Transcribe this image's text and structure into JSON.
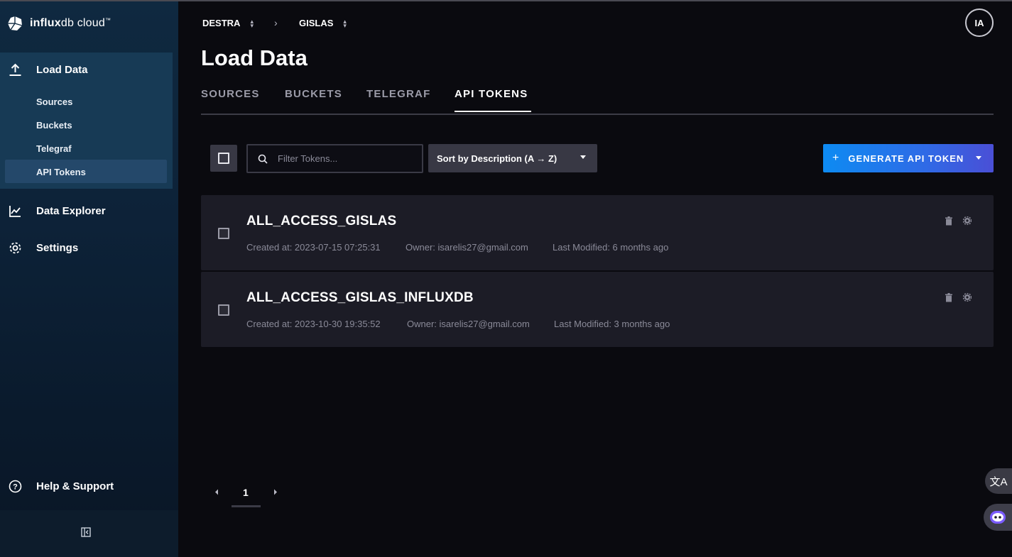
{
  "brand": {
    "name_bold": "influx",
    "name_rest": "db cloud",
    "trademark": "™"
  },
  "sidebar": {
    "load_data": "Load Data",
    "sub_items": [
      {
        "label": "Sources"
      },
      {
        "label": "Buckets"
      },
      {
        "label": "Telegraf"
      },
      {
        "label": "API Tokens",
        "active": true
      }
    ],
    "data_explorer": "Data Explorer",
    "settings": "Settings",
    "help": "Help & Support"
  },
  "breadcrumb": {
    "org": "DESTRA",
    "bucket": "GISLAS"
  },
  "avatar": {
    "initials": "IA"
  },
  "page": {
    "title": "Load Data",
    "tabs": [
      "SOURCES",
      "BUCKETS",
      "TELEGRAF",
      "API TOKENS"
    ],
    "active_tab": "API TOKENS"
  },
  "toolbar": {
    "search_placeholder": "Filter Tokens...",
    "sort_label": "Sort by Description (A → Z)",
    "generate_label": "GENERATE API TOKEN"
  },
  "tokens": [
    {
      "name": "ALL_ACCESS_GISLAS",
      "created": "Created at: 2023-07-15 07:25:31",
      "owner": "Owner: isarelis27@gmail.com",
      "modified": "Last Modified: 6 months ago"
    },
    {
      "name": "ALL_ACCESS_GISLAS_INFLUXDB",
      "created": "Created at: 2023-10-30 19:35:52",
      "owner": "Owner: isarelis27@gmail.com",
      "modified": "Last Modified: 3 months ago"
    }
  ],
  "pagination": {
    "current_page": "1"
  },
  "colors": {
    "accent": "#0d8bf2",
    "accent_end": "#4a4fd6",
    "sidebar_active": "#173a55"
  }
}
